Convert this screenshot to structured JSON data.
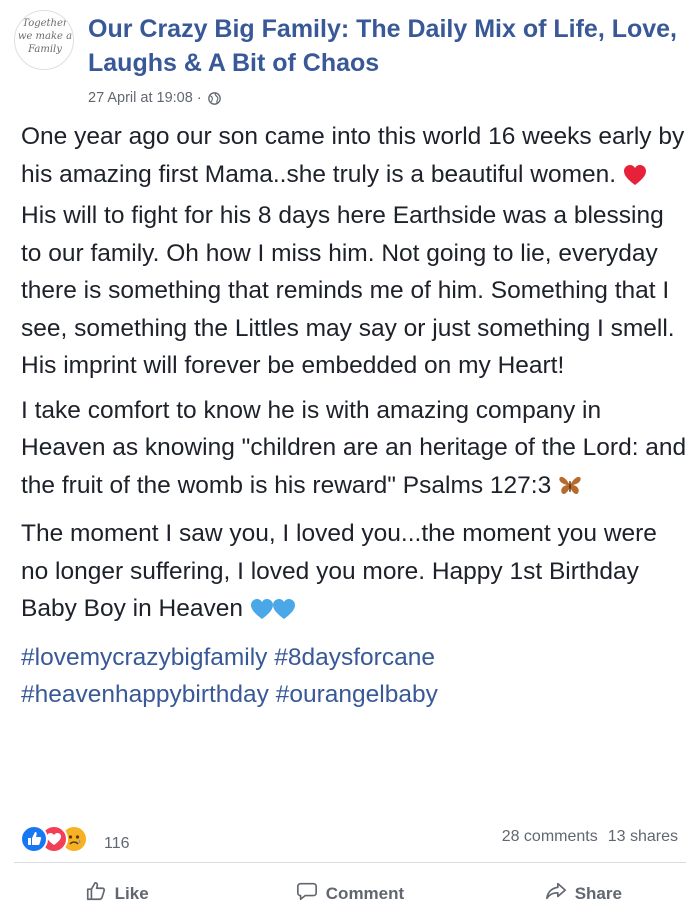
{
  "post": {
    "page_name": "Our Crazy Big Family: The Daily Mix of Life, Love, Laughs & A Bit of Chaos",
    "avatar_text": "Together\nwe make a\nFamily",
    "timestamp": "27 April at 19:08",
    "separator": "·",
    "paragraphs": [
      {
        "before": "One year ago our son came into this world 16 weeks early by his amazing first Mama..she truly is a beautiful women. ",
        "emoji": "heart-icon",
        "after": " His will to fight for his 8 days here Earthside was a blessing to our family. Oh how I miss him. Not going to lie, everyday there is something that reminds me of him. Something that I see, something the Littles may say or just something I smell. His imprint will forever be embedded on my Heart!"
      },
      {
        "before": "I take comfort to know he is with amazing company in Heaven as knowing \"children are an heritage of the Lord: and the fruit of the womb is his reward\" Psalms 127:3 ",
        "emoji": "butterfly-icon"
      },
      {
        "before": "The moment I saw you, I loved you...the moment you were no longer suffering, I loved you more. Happy 1st Birthday Baby Boy in Heaven ",
        "emoji": "blue-hearts-icon"
      }
    ],
    "hashtags": [
      "#lovemycrazybigfamily",
      "#8daysforcane",
      "#heavenhappybirthday",
      "#ourangelbaby"
    ]
  },
  "stats": {
    "reaction_icons": [
      "like-reaction-icon",
      "love-reaction-icon",
      "sad-reaction-icon"
    ],
    "reaction_count": "116",
    "comments": "28 comments",
    "shares": "13 shares"
  },
  "actions": {
    "like": "Like",
    "comment": "Comment",
    "share": "Share"
  },
  "colors": {
    "link": "#385898",
    "text": "#1d2129",
    "meta": "#616770",
    "like_blue": "#1877f2",
    "love_red": "#f33e58",
    "sad_yellow": "#f7b125"
  }
}
